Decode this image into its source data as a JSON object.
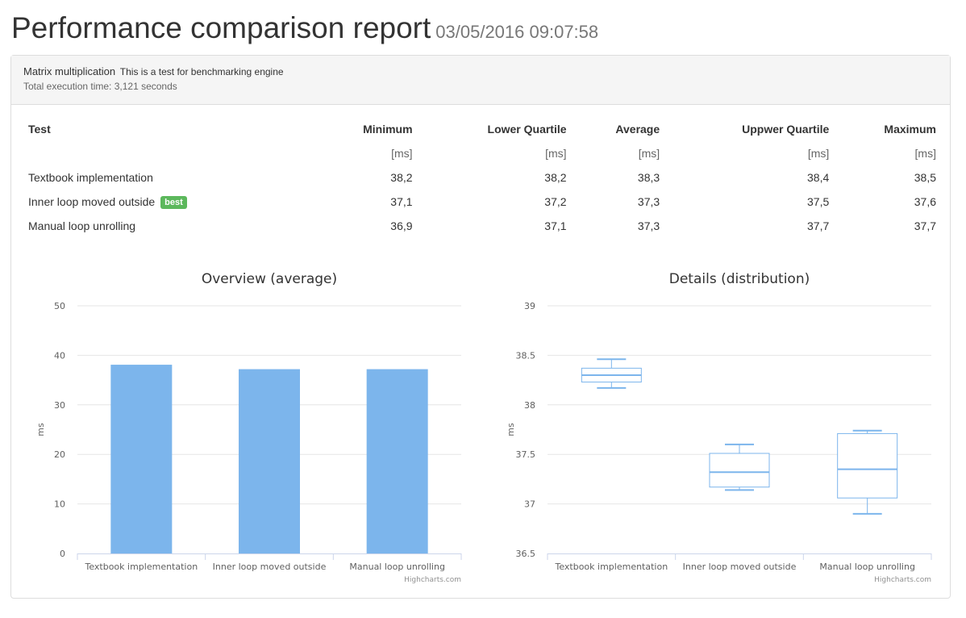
{
  "header": {
    "title": "Performance comparison report",
    "date": "03/05/2016 09:07:58"
  },
  "suite": {
    "name": "Matrix multiplication",
    "description": "This is a test for benchmarking engine",
    "total_time": "Total execution time: 3,121 seconds"
  },
  "table": {
    "headers": [
      "Test",
      "Minimum",
      "Lower Quartile",
      "Average",
      "Uppwer Quartile",
      "Maximum"
    ],
    "units": [
      "",
      "[ms]",
      "[ms]",
      "[ms]",
      "[ms]",
      "[ms]"
    ],
    "rows": [
      {
        "name": "Textbook implementation",
        "badge": "",
        "values": [
          "38,2",
          "38,2",
          "38,3",
          "38,4",
          "38,5"
        ]
      },
      {
        "name": "Inner loop moved outside",
        "badge": "best",
        "values": [
          "37,1",
          "37,2",
          "37,3",
          "37,5",
          "37,6"
        ]
      },
      {
        "name": "Manual loop unrolling",
        "badge": "",
        "values": [
          "36,9",
          "37,1",
          "37,3",
          "37,7",
          "37,7"
        ]
      }
    ]
  },
  "chart_data": [
    {
      "type": "bar",
      "title": "Overview (average)",
      "categories": [
        "Textbook implementation",
        "Inner loop moved outside",
        "Manual loop unrolling"
      ],
      "values": [
        38.1,
        37.2,
        37.2
      ],
      "ylabel": "ms",
      "ylim": [
        0,
        50
      ],
      "yticks": [
        0,
        10,
        20,
        30,
        40,
        50
      ],
      "ytick_labels": [
        "0",
        "10",
        "20",
        "30",
        "40",
        "50"
      ],
      "grid": true,
      "color": "#7cb5ec",
      "credit": "Highcharts.com"
    },
    {
      "type": "boxplot",
      "title": "Details (distribution)",
      "categories": [
        "Textbook implementation",
        "Inner loop moved outside",
        "Manual loop unrolling"
      ],
      "boxes": [
        {
          "low": 38.17,
          "q1": 38.23,
          "median": 38.3,
          "q3": 38.37,
          "high": 38.46
        },
        {
          "low": 37.14,
          "q1": 37.17,
          "median": 37.32,
          "q3": 37.51,
          "high": 37.6
        },
        {
          "low": 36.9,
          "q1": 37.06,
          "median": 37.35,
          "q3": 37.71,
          "high": 37.74
        }
      ],
      "ylabel": "ms",
      "ylim": [
        36.5,
        39
      ],
      "yticks": [
        36.5,
        37,
        37.5,
        38,
        38.5,
        39
      ],
      "ytick_labels": [
        "36.5",
        "37",
        "37.5",
        "38",
        "38.5",
        "39"
      ],
      "grid": true,
      "color": "#7cb5ec",
      "credit": "Highcharts.com"
    }
  ]
}
